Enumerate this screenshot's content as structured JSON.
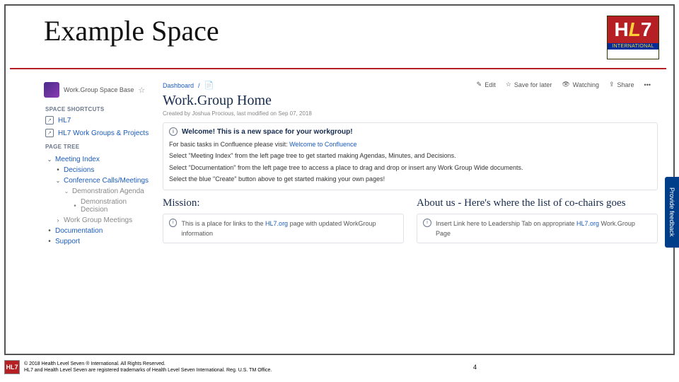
{
  "slide": {
    "title": "Example Space",
    "logo": {
      "top": "HL7",
      "bottom": "INTERNATIONAL"
    }
  },
  "sidebar": {
    "space_name": "Work.Group Space Base",
    "sections": {
      "shortcuts_label": "SPACE SHORTCUTS",
      "shortcuts": [
        {
          "label": "HL7"
        },
        {
          "label": "HL7 Work Groups & Projects"
        }
      ],
      "pagetree_label": "PAGE TREE",
      "tree": {
        "l0": "Meeting Index",
        "l1a": "Decisions",
        "l1b": "Conference Calls/Meetings",
        "l2a": "Demonstration Agenda",
        "l3a": "Demonstration Decision",
        "l1c": "Work Group Meetings",
        "l0b": "Documentation",
        "l0c": "Support"
      }
    }
  },
  "main": {
    "crumb": "Dashboard",
    "toolbar": {
      "edit": "Edit",
      "save": "Save for later",
      "watch": "Watching",
      "share": "Share"
    },
    "title": "Work.Group Home",
    "byline": "Created by Joshua Procious, last modified on Sep 07, 2018",
    "welcome": {
      "heading": "Welcome! This is a new space for your workgroup!",
      "l1a": "For basic tasks in Confluence please visit: ",
      "l1b": "Welcome to Confluence",
      "l2": "Select \"Meeting Index\" from the left page tree to get started making Agendas, Minutes, and Decisions.",
      "l3": "Select \"Documentation\" from the left page tree to access a place to drag and drop or insert any Work Group Wide documents.",
      "l4": "Select the blue \"Create\" button above to get started making your own pages!"
    },
    "mission": {
      "heading": "Mission:",
      "body_a": "This is a place for links to the ",
      "body_link": "HL7.org",
      "body_b": " page with updated WorkGroup information"
    },
    "about": {
      "heading": "About us - Here's where the list of co-chairs goes",
      "body_a": "Insert Link here to Leadership Tab on appropriate ",
      "body_link": "HL7.org",
      "body_b": " Work.Group Page"
    }
  },
  "feedback": "Provide feedback",
  "footer": {
    "line1": "© 2018 Health Level Seven ® International. All Rights Reserved.",
    "line2": "HL7 and Health Level Seven are registered trademarks of Health Level Seven International. Reg. U.S. TM Office.",
    "page": "4",
    "logo": "HL7"
  }
}
